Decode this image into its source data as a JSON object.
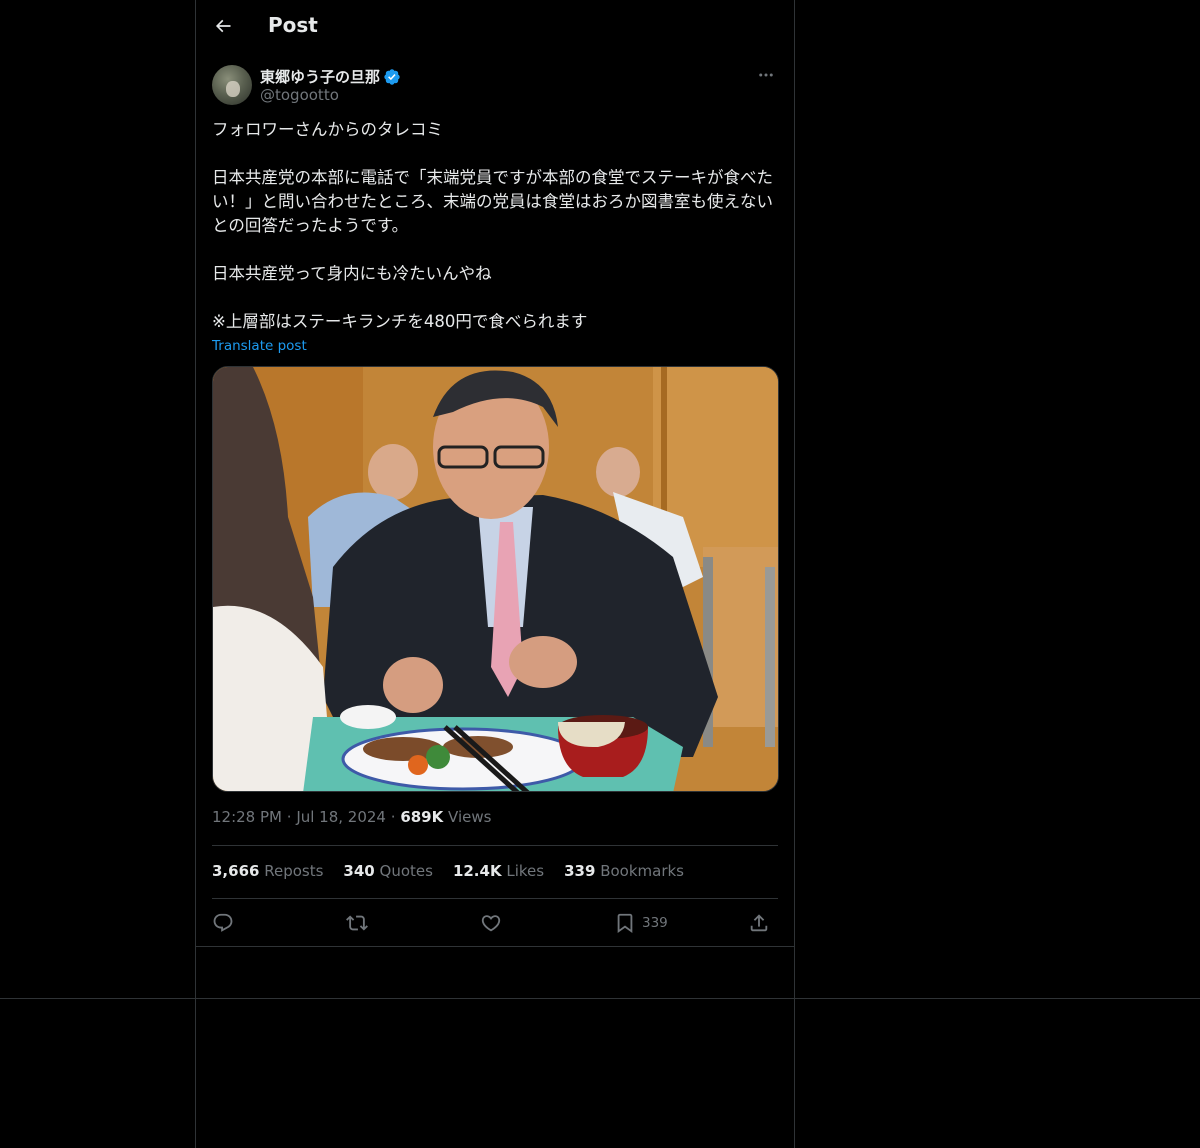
{
  "header": {
    "title": "Post"
  },
  "author": {
    "display_name": "東郷ゆう子の旦那",
    "handle": "@togootto",
    "verified_color": "#1d9bf0"
  },
  "post": {
    "lines": [
      "フォロワーさんからのタレコミ",
      "",
      "日本共産党の本部に電話で「末端党員ですが本部の食堂でステーキが食べたい！」と問い合わせたところ、末端の党員は食堂はおろか図書室も使えないとの回答だったようです。",
      "",
      "日本共産党って身内にも冷たいんやね",
      "",
      "※上層部はステーキランチを480円で食べられます"
    ],
    "translate_label": "Translate post",
    "time": "12:28 PM",
    "date": "Jul 18, 2024",
    "views_count": "689K",
    "views_label": "Views"
  },
  "stats": {
    "reposts_count": "3,666",
    "reposts_label": "Reposts",
    "quotes_count": "340",
    "quotes_label": "Quotes",
    "likes_count": "12.4K",
    "likes_label": "Likes",
    "bookmarks_count": "339",
    "bookmarks_label": "Bookmarks"
  },
  "actions": {
    "reply_icon": "reply-icon",
    "repost_icon": "repost-icon",
    "like_icon": "heart-icon",
    "bookmark_icon": "bookmark-icon",
    "bookmark_count": "339",
    "share_icon": "share-icon"
  },
  "colors": {
    "background": "#000000",
    "text": "#e7e9ea",
    "secondary": "#71767b",
    "accent": "#1d9bf0",
    "border": "#2f3336"
  }
}
